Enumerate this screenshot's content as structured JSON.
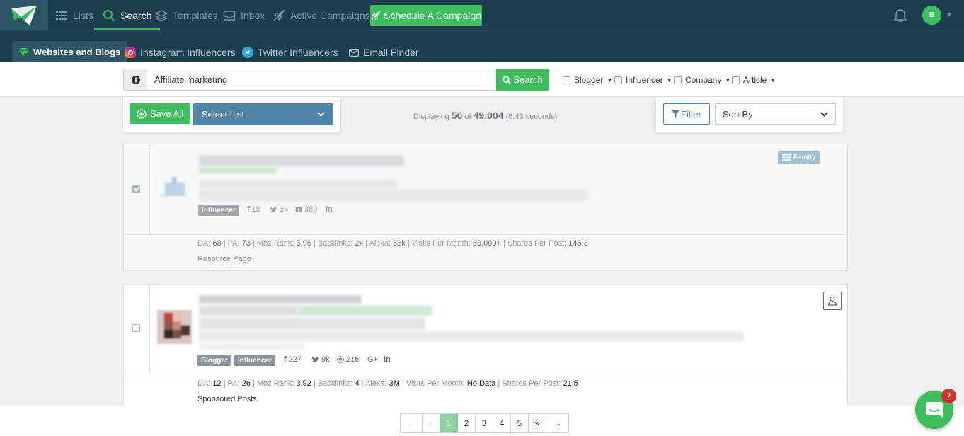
{
  "nav": {
    "items": [
      {
        "label": "Lists",
        "icon": "list-icon"
      },
      {
        "label": "Search",
        "icon": "search-icon"
      },
      {
        "label": "Templates",
        "icon": "layers-icon"
      },
      {
        "label": "Inbox",
        "icon": "inbox-icon"
      },
      {
        "label": "Active Campaigns",
        "icon": "rocket-icon"
      }
    ],
    "schedule_label": "Schedule A Campaign",
    "avatar_initial": "B"
  },
  "subnav": {
    "items": [
      {
        "label": "Websites and Blogs",
        "icon": "gem-icon"
      },
      {
        "label": "Instagram Influencers",
        "icon": "instagram-icon"
      },
      {
        "label": "Twitter Influencers",
        "icon": "twitter-icon"
      },
      {
        "label": "Email Finder",
        "icon": "envelope-icon"
      }
    ]
  },
  "search": {
    "value": "Affiliate marketing",
    "button_label": "Search",
    "filters": [
      "Blogger",
      "Influencer",
      "Company",
      "Article"
    ]
  },
  "toolbar": {
    "save_all_label": "Save All",
    "select_list_label": "Select List",
    "display_prefix": "Displaying",
    "display_count": "50",
    "display_of": "of",
    "display_total": "49,004",
    "display_time": "(6.43 seconds)",
    "filter_label": "Filter",
    "sort_label": "Sort By"
  },
  "results": [
    {
      "checked": true,
      "badge": "Family",
      "tags": [
        "Influencer"
      ],
      "social": {
        "facebook": "1k",
        "twitter": "3k",
        "youtube": "389"
      },
      "stats": {
        "da": "68",
        "pa": "73",
        "moz_rank": "5.96",
        "backlinks": "2k",
        "alexa": "53k",
        "visits": "60,000+",
        "shares": "145.3"
      },
      "category": "Resource Page"
    },
    {
      "checked": false,
      "tags": [
        "Blogger",
        "Influencer"
      ],
      "social": {
        "facebook": "227",
        "twitter": "9k",
        "pinterest": "216"
      },
      "stats": {
        "da": "12",
        "pa": "26",
        "moz_rank": "3.92",
        "backlinks": "4",
        "alexa": "3M",
        "visits": "No Data",
        "shares": "21.5"
      },
      "category": "Sponsored Posts"
    }
  ],
  "stat_labels": {
    "da": "DA:",
    "pa": "PA:",
    "moz_rank": "Moz Rank:",
    "backlinks": "Backlinks:",
    "alexa": "Alexa:",
    "visits": "Visits Per Month:",
    "shares": "Shares Per Post:"
  },
  "pagination": {
    "pages": [
      "←",
      "«",
      "1",
      "2",
      "3",
      "4",
      "5",
      "»",
      "→"
    ],
    "current": "1"
  },
  "chat": {
    "unread": "7"
  },
  "colors": {
    "nav_bg": "#1b3f4f",
    "accent_green": "#3dbd5d",
    "select_blue": "#4f84a6"
  }
}
